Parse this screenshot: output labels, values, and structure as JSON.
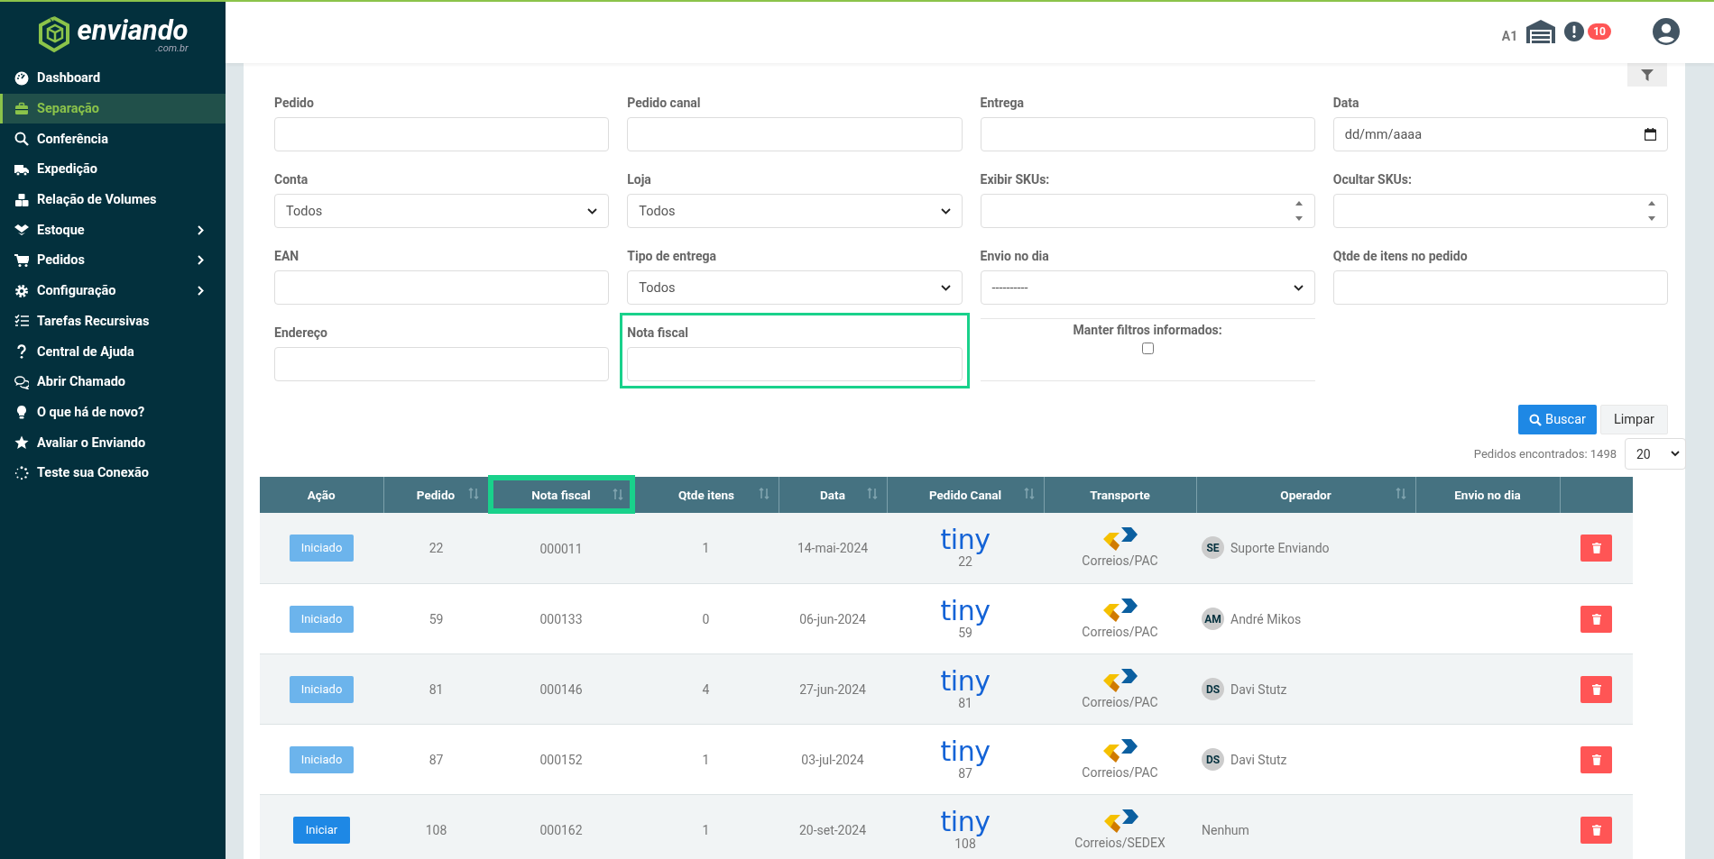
{
  "logo": {
    "name": "enviando",
    "domain": ".com.br"
  },
  "sidebar": {
    "items": [
      {
        "label": "Dashboard",
        "selected": false,
        "expandable": false
      },
      {
        "label": "Separação",
        "selected": true,
        "expandable": false
      },
      {
        "label": "Conferência",
        "selected": false,
        "expandable": false
      },
      {
        "label": "Expedição",
        "selected": false,
        "expandable": false
      },
      {
        "label": "Relação de Volumes",
        "selected": false,
        "expandable": false
      },
      {
        "label": "Estoque",
        "selected": false,
        "expandable": true
      },
      {
        "label": "Pedidos",
        "selected": false,
        "expandable": true
      },
      {
        "label": "Configuração",
        "selected": false,
        "expandable": true
      },
      {
        "label": "Tarefas Recursivas",
        "selected": false,
        "expandable": false
      },
      {
        "label": "Central de Ajuda",
        "selected": false,
        "expandable": false
      },
      {
        "label": "Abrir Chamado",
        "selected": false,
        "expandable": false
      },
      {
        "label": "O que há de novo?",
        "selected": false,
        "expandable": false
      },
      {
        "label": "Avaliar o Enviando",
        "selected": false,
        "expandable": false
      },
      {
        "label": "Teste sua Conexão",
        "selected": false,
        "expandable": false
      }
    ]
  },
  "header": {
    "warehouse": "A1",
    "alert_count": "10"
  },
  "filters": [
    {
      "kind": "text",
      "label": "Pedido",
      "highlighted": false
    },
    {
      "kind": "text",
      "label": "Pedido canal",
      "highlighted": false
    },
    {
      "kind": "text",
      "label": "Entrega",
      "highlighted": false
    },
    {
      "kind": "date",
      "label": "Data",
      "placeholder": "dd/mm/aaaa",
      "highlighted": false
    },
    {
      "kind": "select",
      "label": "Conta",
      "value": "Todos",
      "highlighted": false
    },
    {
      "kind": "select",
      "label": "Loja",
      "value": "Todos",
      "highlighted": false
    },
    {
      "kind": "number",
      "label": "Exibir SKUs:",
      "highlighted": false
    },
    {
      "kind": "number",
      "label": "Ocultar SKUs:",
      "highlighted": false
    },
    {
      "kind": "text",
      "label": "EAN",
      "highlighted": false
    },
    {
      "kind": "select",
      "label": "Tipo de entrega",
      "value": "Todos",
      "highlighted": false
    },
    {
      "kind": "select",
      "label": "Envio no dia",
      "value": "----------",
      "highlighted": false
    },
    {
      "kind": "text",
      "label": "Qtde de itens no pedido",
      "highlighted": false
    },
    {
      "kind": "text",
      "label": "Endereço",
      "highlighted": false
    },
    {
      "kind": "text",
      "label": "Nota fiscal",
      "highlighted": true
    },
    {
      "kind": "checkbox",
      "label": "Manter filtros informados:",
      "checked": false,
      "highlighted": false
    }
  ],
  "buttons": [
    {
      "label": "Buscar",
      "kind": "primary"
    },
    {
      "label": "Limpar",
      "kind": "secondary"
    }
  ],
  "results": {
    "label": "Pedidos encontrados: 1498",
    "page_size": "20"
  },
  "table": {
    "columns": [
      {
        "label": "Ação",
        "sortable": false,
        "highlighted": false
      },
      {
        "label": "Pedido",
        "sortable": true,
        "highlighted": false
      },
      {
        "label": "Nota fiscal",
        "sortable": true,
        "highlighted": true
      },
      {
        "label": "Qtde itens",
        "sortable": true,
        "highlighted": false
      },
      {
        "label": "Data",
        "sortable": true,
        "highlighted": false
      },
      {
        "label": "Pedido Canal",
        "sortable": true,
        "highlighted": false
      },
      {
        "label": "Transporte",
        "sortable": false,
        "highlighted": false
      },
      {
        "label": "Operador",
        "sortable": true,
        "highlighted": false
      },
      {
        "label": "Envio no dia",
        "sortable": false,
        "highlighted": false
      },
      {
        "sortable": false,
        "highlighted": false
      }
    ],
    "rows": [
      {
        "action": "Iniciado",
        "started": true,
        "pedido": "22",
        "nota": "000011",
        "qtde": "1",
        "data": "14-mai-2024",
        "channel": "tiny",
        "channel_id": "22",
        "transport": "Correios/PAC",
        "operator_initials": "SE",
        "operator": "Suporte Enviando"
      },
      {
        "action": "Iniciado",
        "started": true,
        "pedido": "59",
        "nota": "000133",
        "qtde": "0",
        "data": "06-jun-2024",
        "channel": "tiny",
        "channel_id": "59",
        "transport": "Correios/PAC",
        "operator_initials": "AM",
        "operator": "André Mikos"
      },
      {
        "action": "Iniciado",
        "started": true,
        "pedido": "81",
        "nota": "000146",
        "qtde": "4",
        "data": "27-jun-2024",
        "channel": "tiny",
        "channel_id": "81",
        "transport": "Correios/PAC",
        "operator_initials": "DS",
        "operator": "Davi Stutz"
      },
      {
        "action": "Iniciado",
        "started": true,
        "pedido": "87",
        "nota": "000152",
        "qtde": "1",
        "data": "03-jul-2024",
        "channel": "tiny",
        "channel_id": "87",
        "transport": "Correios/PAC",
        "operator_initials": "DS",
        "operator": "Davi Stutz"
      },
      {
        "action": "Iniciar",
        "started": false,
        "pedido": "108",
        "nota": "000162",
        "qtde": "1",
        "data": "20-set-2024",
        "channel": "tiny",
        "channel_id": "108",
        "transport": "Correios/SEDEX",
        "operator": "Nenhum"
      }
    ]
  }
}
